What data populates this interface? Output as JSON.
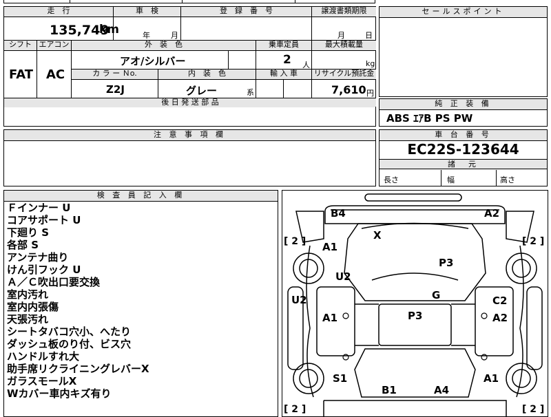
{
  "top_strip": {
    "partial_text": "西 修 州"
  },
  "main_table": {
    "mileage_label": "走　行",
    "mileage_value": "135,749",
    "mileage_unit": "km",
    "inspection_label": "車　検",
    "inspection_year_unit": "年",
    "inspection_month_unit": "月",
    "registration_label": "登　録　番　号",
    "transfer_deadline_label": "譲渡書類期限",
    "transfer_month_unit": "月",
    "transfer_day_unit": "日",
    "shift_label": "シフト",
    "aircon_label": "エアコン",
    "exterior_color_label": "外　装　色",
    "capacity_label": "乗車定員",
    "max_load_label": "最大積載量",
    "shift_value": "FAT",
    "aircon_value": "AC",
    "exterior_color_value": "アオ/シルバー",
    "capacity_value": "2",
    "capacity_unit": "人",
    "max_load_unit": "kg",
    "color_no_label": "カ ラ ー Ｎo.",
    "interior_color_label": "内　装　色",
    "import_label": "輸 入 車",
    "recycle_label": "リサイクル預託金",
    "color_no_value": "Z2J",
    "interior_color_value": "グレー",
    "interior_color_suffix": "系",
    "recycle_value": "7,610",
    "recycle_unit": "円",
    "later_parts_label": "後 日 発 送 部 品"
  },
  "notes_section": {
    "label": "注 意 事 項 欄"
  },
  "sales_points": {
    "label": "セールスポイント"
  },
  "equipment": {
    "label": "純 正 装 備",
    "value": "ABS ｴｱB PS PW"
  },
  "chassis": {
    "label": "車 台 番 号",
    "value": "EC22S-123644"
  },
  "dimensions": {
    "label": "諸　元",
    "length_label": "長さ",
    "width_label": "幅",
    "height_label": "高さ"
  },
  "inspector": {
    "label": "検 査 員 記 入 欄",
    "lines": [
      "Ｆインナー U",
      "コアサポート U",
      "下廻り S",
      "各部 S",
      "アンテナ曲り",
      "けん引フック U",
      "Ａ／Ｃ吹出口要交換",
      "室内汚れ",
      "室内内張傷",
      "天張汚れ",
      "シートタバコ穴小、へたり",
      "ダッシュ板のり付、ビス穴",
      "ハンドルすれ大",
      "助手席リクライニングレバーX",
      "ガラスモールX",
      "Wカバー車内キズ有り"
    ]
  },
  "diagram": {
    "marks": {
      "b4": "B4",
      "a2_top": "A2",
      "x": "X",
      "a1_upper": "A1",
      "p3_upper": "P3",
      "u2_upper": "U2",
      "g": "G",
      "u2_left": "U2",
      "a1_mid": "A1",
      "p3_mid": "P3",
      "c2": "C2",
      "a2_mid": "A2",
      "s1": "S1",
      "b1": "B1",
      "a4": "A4",
      "a1_lower": "A1"
    },
    "tire_tl": "[ 2 ]",
    "tire_tr": "[ 2 ]",
    "tire_bl": "[ 2 ]",
    "tire_br": "[ 2 ]"
  }
}
